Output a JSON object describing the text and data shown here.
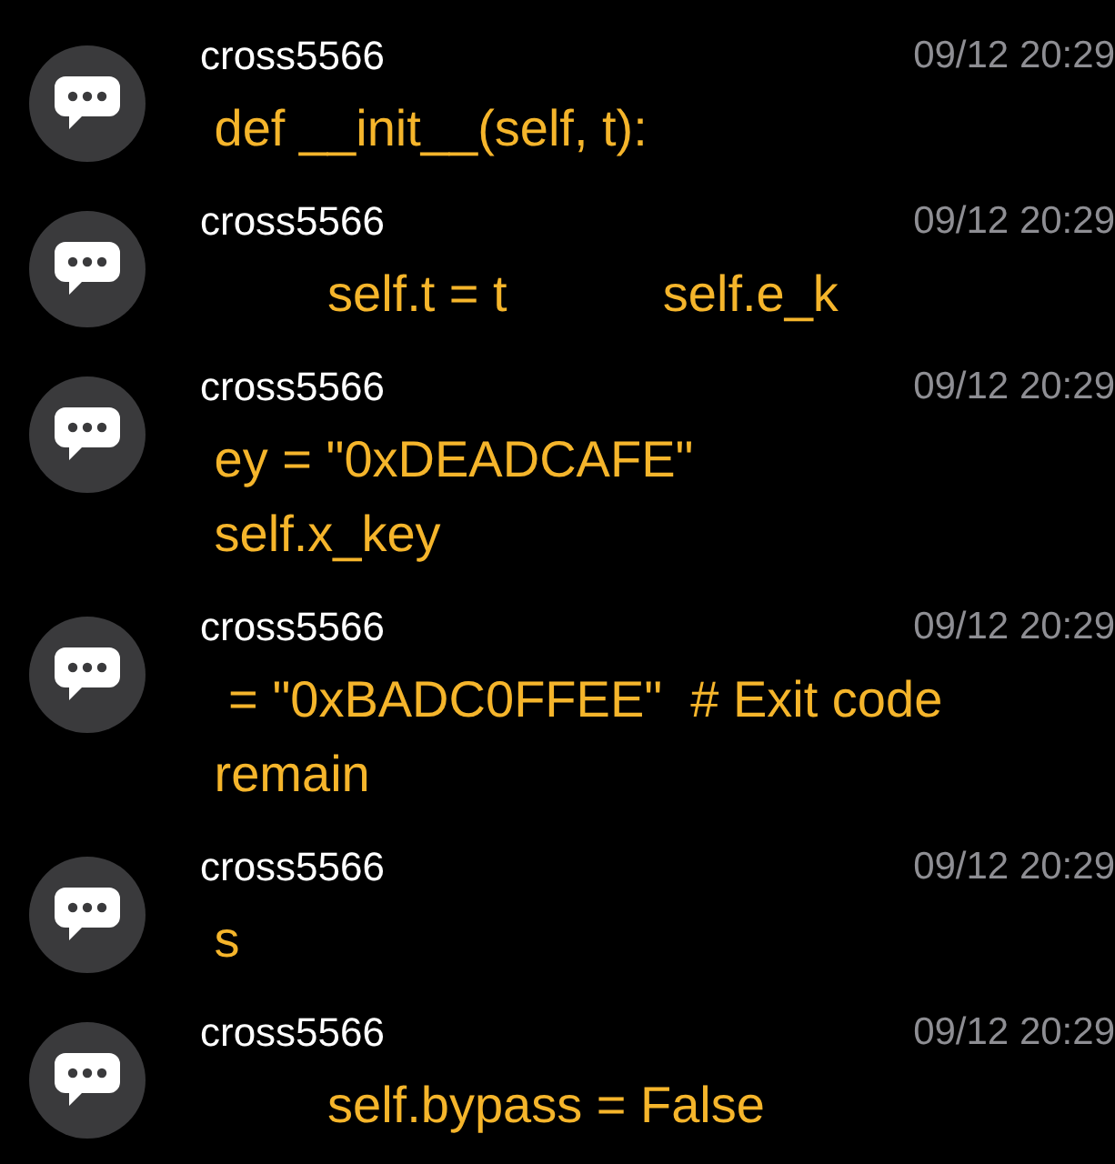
{
  "messages": [
    {
      "sender": "cross5566",
      "time": "09/12 20:29",
      "lines": [
        " def __init__(self, t):"
      ]
    },
    {
      "sender": "cross5566",
      "time": "09/12 20:29",
      "lines": [
        "         self.t = t           self.e_k"
      ]
    },
    {
      "sender": "cross5566",
      "time": "09/12 20:29",
      "lines": [
        " ey = \"0xDEADCAFE\"",
        " self.x_key"
      ]
    },
    {
      "sender": "cross5566",
      "time": "09/12 20:29",
      "lines": [
        "  = \"0xBADC0FFEE\"  # Exit code",
        " remain"
      ]
    },
    {
      "sender": "cross5566",
      "time": "09/12 20:29",
      "lines": [
        " s"
      ]
    },
    {
      "sender": "cross5566",
      "time": "09/12 20:29",
      "lines": [
        "         self.bypass = False"
      ]
    }
  ]
}
